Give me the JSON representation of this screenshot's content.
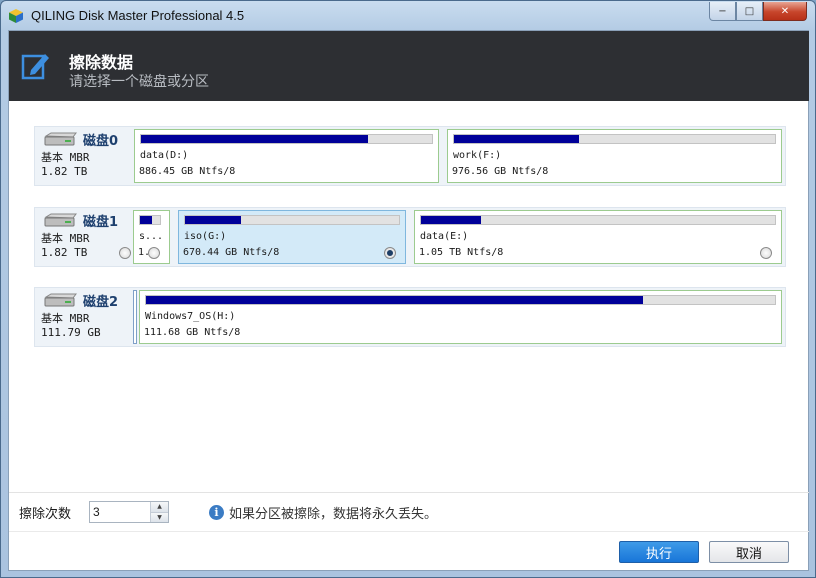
{
  "window": {
    "title": "QILING Disk Master Professional 4.5",
    "controls": {
      "minimize": "−",
      "maximize": "□",
      "close": "✕"
    }
  },
  "header": {
    "title": "擦除数据",
    "subtitle": "请选择一个磁盘或分区",
    "icon": "edit-icon"
  },
  "disks": [
    {
      "name": "磁盘0",
      "type": "基本 MBR",
      "size": "1.82 TB",
      "partitions": [
        {
          "label": "data(D:)",
          "info": "886.45 GB Ntfs/8",
          "used_fraction": 0.78
        },
        {
          "label": "work(F:)",
          "info": "976.56 GB Ntfs/8",
          "used_fraction": 0.39
        }
      ]
    },
    {
      "name": "磁盘1",
      "type": "基本 MBR",
      "size": "1.82 TB",
      "partitions": [
        {
          "label": "s...",
          "info": "1.",
          "used_fraction": 0.6
        },
        {
          "label": "iso(G:)",
          "info": "670.44 GB Ntfs/8",
          "used_fraction": 0.26,
          "selected": true
        },
        {
          "label": "data(E:)",
          "info": "1.05 TB Ntfs/8",
          "used_fraction": 0.17
        }
      ]
    },
    {
      "name": "磁盘2",
      "type": "基本 MBR",
      "size": "111.79 GB",
      "partitions": [
        {
          "label": "Windows7_OS(H:)",
          "info": "111.68 GB Ntfs/8",
          "used_fraction": 0.79
        }
      ]
    }
  ],
  "footer": {
    "wipe_label": "擦除次数",
    "wipe_count": "3",
    "note": "如果分区被擦除，数据将永久丢失。",
    "execute": "执行",
    "cancel": "取消"
  },
  "colors": {
    "header_bg": "#2d2f33",
    "bar_fill": "#000099",
    "partition_border": "#9ccb8f",
    "primary_button": "#1875d8"
  }
}
